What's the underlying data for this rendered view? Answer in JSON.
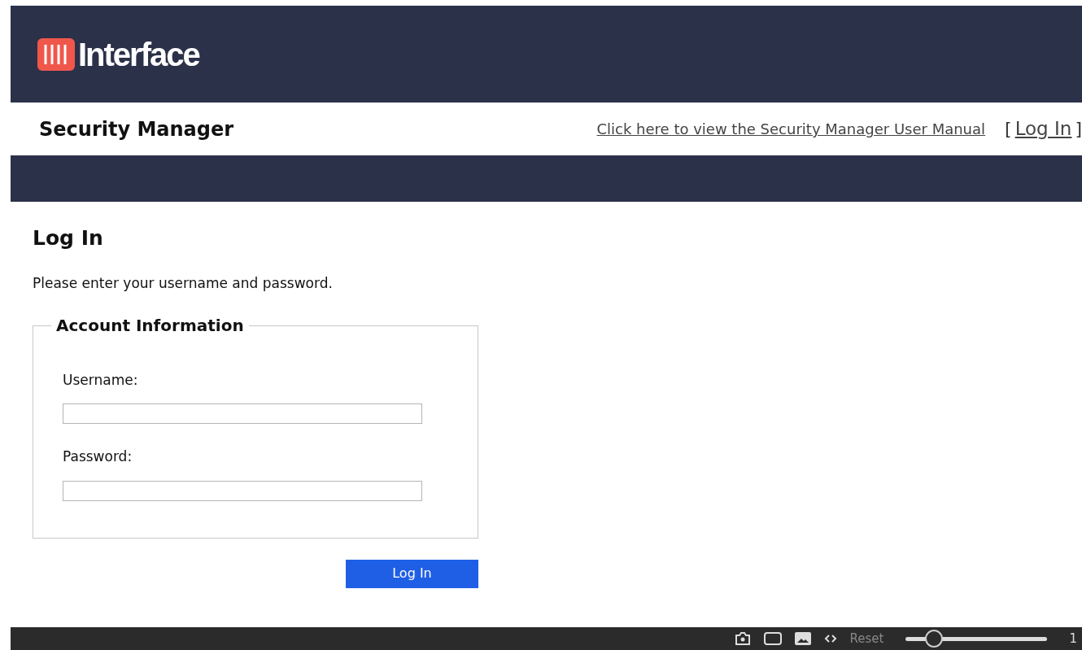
{
  "header": {
    "logo_text": "Interface"
  },
  "subheader": {
    "title": "Security Manager",
    "manual_link": "Click here to view the Security Manager User Manual",
    "bracket_open": "[",
    "login_link": "Log In",
    "bracket_close": "]"
  },
  "page": {
    "heading": "Log In",
    "instructions": "Please enter your username and password.",
    "fieldset": {
      "legend": "Account Information",
      "fields": [
        {
          "label": "Username:"
        },
        {
          "label": "Password:"
        }
      ]
    },
    "submit": "Log In"
  },
  "toolbar": {
    "reset": "Reset",
    "zoom": {
      "level": 0.2
    },
    "zoom_reading": "1"
  }
}
